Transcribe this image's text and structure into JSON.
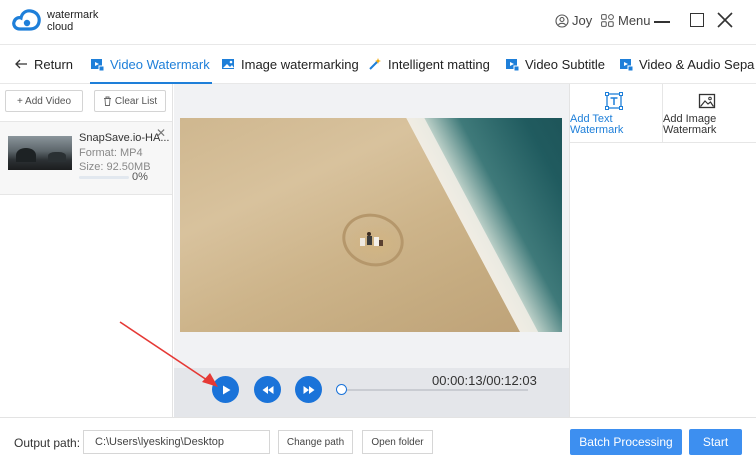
{
  "app": {
    "logo_line1": "watermark",
    "logo_line2": "cloud",
    "user_name": "Joy",
    "menu_label": "Menu"
  },
  "tabs": [
    {
      "label": "Return",
      "icon": "arrow-left-icon"
    },
    {
      "label": "Video Watermark",
      "icon": "video-watermark-icon",
      "active": true
    },
    {
      "label": "Image watermarking",
      "icon": "image-icon"
    },
    {
      "label": "Intelligent matting",
      "icon": "magic-wand-icon"
    },
    {
      "label": "Video Subtitle",
      "icon": "subtitle-icon"
    },
    {
      "label": "Video & Audio Sepa",
      "icon": "audio-separation-icon"
    }
  ],
  "left_panel": {
    "add_video": "+ Add Video",
    "clear_list": "Clear List",
    "file": {
      "name": "SnapSave.io-HA...",
      "format": "Format:  MP4",
      "size": "Size:  92.50MB",
      "progress": "0%",
      "progress_value": 0
    }
  },
  "player": {
    "timecode": "00:00:13/00:12:03",
    "position_fraction": 0.018
  },
  "right_panel": {
    "add_text_line1": "Add Text",
    "add_text_line2": "Watermark",
    "add_image_line1": "Add Image",
    "add_image_line2": "Watermark"
  },
  "bottom": {
    "output_label": "Output path:",
    "output_path": "C:\\Users\\lyesking\\Desktop",
    "change_path": "Change path",
    "open_folder": "Open folder",
    "batch_processing": "Batch Processing",
    "start": "Start"
  },
  "colors": {
    "accent": "#1e7fd9",
    "primary_button": "#3d8ff0",
    "player_button": "#1a73d9",
    "annotation_arrow": "#e53935"
  }
}
